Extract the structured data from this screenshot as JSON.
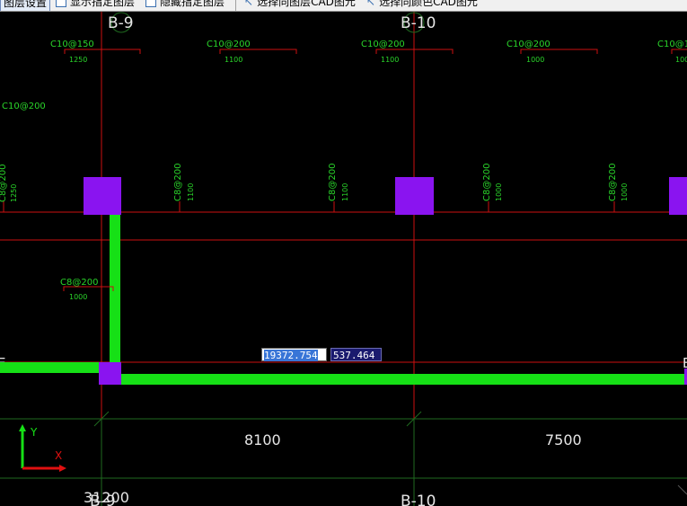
{
  "toolbar": {
    "items": [
      {
        "label": "图层设置"
      },
      {
        "label": "显示指定图层"
      },
      {
        "label": "隐藏指定图层"
      },
      {
        "label": "选择同图层CAD图元"
      },
      {
        "label": "选择同颜色CAD图元"
      }
    ]
  },
  "axes": {
    "top_b9": "B-9",
    "top_b10": "B-10",
    "bottom_b10": "B-10",
    "bottom_b9_partial": "B-9",
    "left_e": "E",
    "right_e": "E"
  },
  "rebar": {
    "top_row": [
      {
        "spec": "C10@150",
        "len": "1250"
      },
      {
        "spec": "C10@200",
        "len": "1100"
      },
      {
        "spec": "C10@200",
        "len": "1100"
      },
      {
        "spec": "C10@200",
        "len": "1000"
      },
      {
        "spec": "C10@1",
        "len": "100"
      }
    ],
    "left_label": "C10@200",
    "vertical": [
      {
        "spec": "C8@200",
        "len": "1250"
      },
      {
        "spec": "C8@200",
        "len": "1100"
      },
      {
        "spec": "C8@200",
        "len": "1100"
      },
      {
        "spec": "C8@200",
        "len": "1000"
      },
      {
        "spec": "C8@200",
        "len": "1000"
      }
    ],
    "mid_label": {
      "spec": "C8@200",
      "len": "1000"
    }
  },
  "dimensions": {
    "span1": "8100",
    "span2": "7500",
    "bottom": "31200"
  },
  "coordinates": {
    "x_value": "19372.754",
    "y_value": "537.464"
  },
  "ucs": {
    "y": "Y",
    "x": "X"
  },
  "colors": {
    "background": "#000000",
    "axis_line": "#cc1010",
    "grid_green": "#1f6a1f",
    "text_green": "#2ad52a",
    "beam_green": "#16e016",
    "column_purple": "#8a14f0",
    "axis_label": "#e6e6e6"
  }
}
